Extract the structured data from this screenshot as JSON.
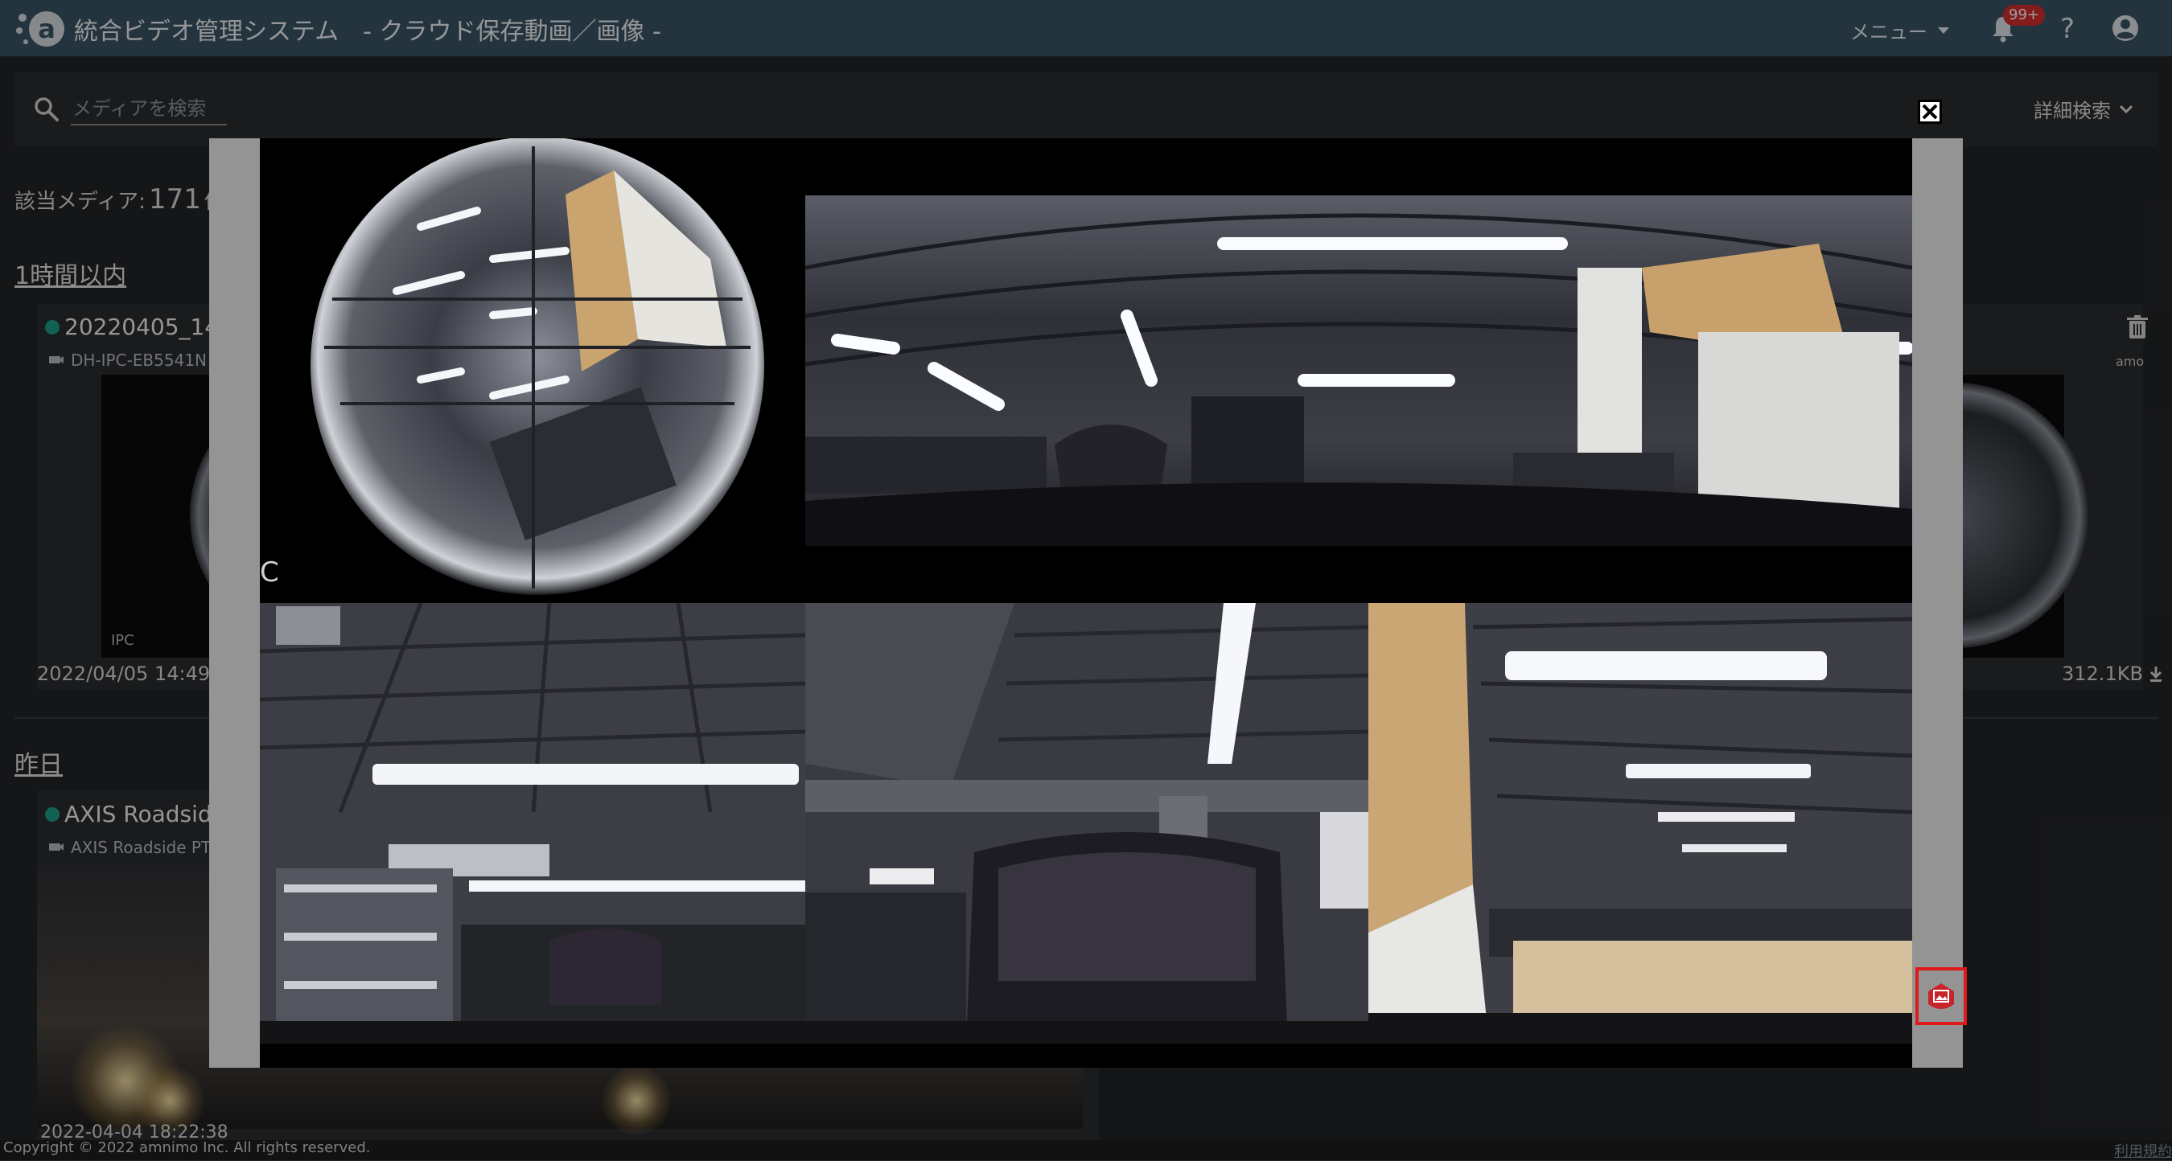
{
  "header": {
    "app_title": "統合ビデオ管理システム",
    "page_subtitle": "- クラウド保存動画／画像 -",
    "menu_label": "メニュー",
    "notification_badge": "99+",
    "brand_color": "#3b5566"
  },
  "search": {
    "placeholder": "メディアを検索",
    "advanced_label": "詳細検索"
  },
  "results": {
    "count_prefix": "該当メディア:",
    "count": "171",
    "count_suffix": "件"
  },
  "sections": [
    {
      "heading": "1時間以内",
      "card": {
        "title": "20220405_14",
        "device": "DH-IPC-EB5541N",
        "thumb_label": "IPC",
        "timestamp": "2022/04/05 14:49",
        "filesize": "312.1KB",
        "user": "amo"
      }
    },
    {
      "heading": "昨日",
      "card": {
        "title": "AXIS Roadside",
        "device": "AXIS Roadside PT",
        "timestamp": "2022-04-04 18:22:38"
      }
    }
  ],
  "modal": {
    "stray_text": "C",
    "panes": [
      {
        "name": "fisheye-original"
      },
      {
        "name": "panorama"
      },
      {
        "name": "split-view-left"
      },
      {
        "name": "split-view-center"
      },
      {
        "name": "split-view-right"
      }
    ]
  },
  "footer": {
    "copyright": "Copyright © 2022 amnimo Inc. All rights reserved.",
    "terms": "利用規約"
  }
}
